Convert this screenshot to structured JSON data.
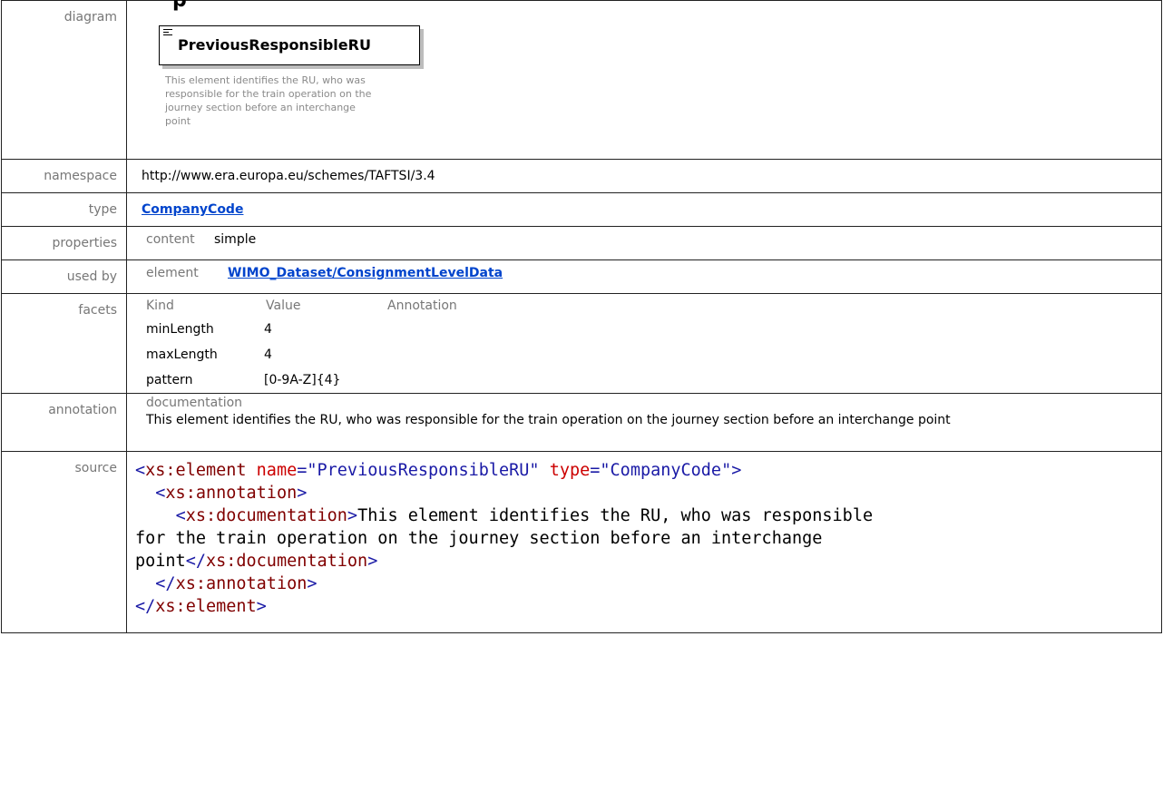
{
  "heading_fragment": "p",
  "rows": {
    "diagram": {
      "label": "diagram",
      "element_name": "PreviousResponsibleRU",
      "element_doc": "This element identifies the RU, who was responsible for the train operation on the journey section before an interchange point"
    },
    "namespace": {
      "label": "namespace",
      "value": "http://www.era.europa.eu/schemes/TAFTSI/3.4"
    },
    "type": {
      "label": "type",
      "value": "CompanyCode"
    },
    "properties": {
      "label": "properties",
      "key": "content",
      "value": "simple"
    },
    "used_by": {
      "label": "used by",
      "key": "element",
      "value": "WIMO_Dataset/ConsignmentLevelData"
    },
    "facets": {
      "label": "facets",
      "headers": [
        "Kind",
        "Value",
        "Annotation"
      ],
      "items": [
        {
          "kind": "minLength",
          "value": "4",
          "annotation": ""
        },
        {
          "kind": "maxLength",
          "value": "4",
          "annotation": ""
        },
        {
          "kind": "pattern",
          "value": "[0-9A-Z]{4}",
          "annotation": ""
        }
      ]
    },
    "annotation": {
      "label": "annotation",
      "caption": "documentation",
      "text": "This element identifies the RU, who was responsible for the train operation on the journey section before an interchange point"
    },
    "source": {
      "label": "source",
      "element_tag": "xs:element",
      "name_attr": "name",
      "name_value": "PreviousResponsibleRU",
      "type_attr": "type",
      "type_value": "CompanyCode",
      "annotation_tag": "xs:annotation",
      "documentation_tag": "xs:documentation",
      "documentation_text_line1": "This element identifies the RU, who was responsible",
      "documentation_text_line2": "for the train operation on the journey section before an interchange",
      "documentation_text_line3": "point"
    }
  }
}
